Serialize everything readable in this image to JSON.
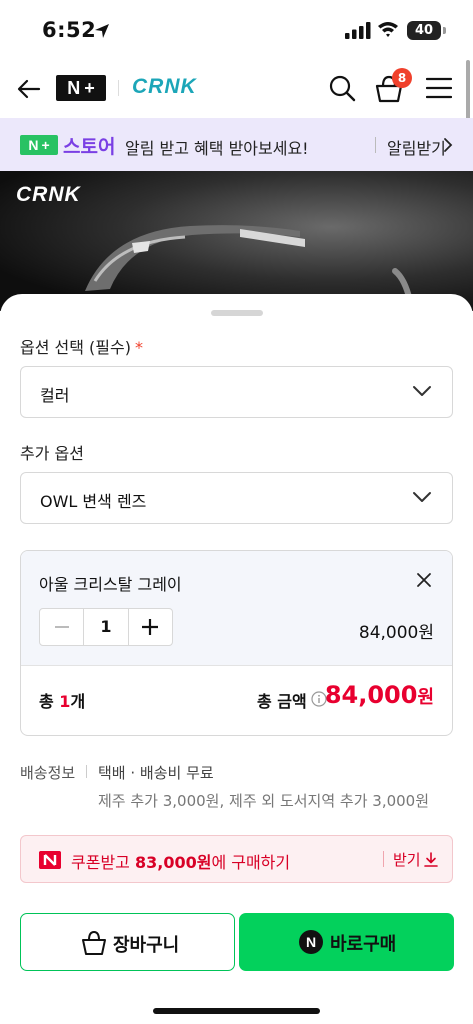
{
  "status_bar": {
    "time": "6:52",
    "battery": "40"
  },
  "header": {
    "brand": "CRNK",
    "cart_count": "8"
  },
  "promo": {
    "store_name": "스토어",
    "message": "알림 받고 혜택 받아보세요!",
    "action": "알림받기"
  },
  "product": {
    "brand_mark": "CRNK"
  },
  "options": {
    "required_label": "옵션 선택 (필수)",
    "required_star": "*",
    "color_select_value": "컬러",
    "extra_label": "추가 옵션",
    "extra_select_value": "OWL 변색 렌즈"
  },
  "selected_item": {
    "name": "아울 크리스탈 그레이",
    "quantity": "1",
    "price": "84,000원",
    "total_prefix": "총 ",
    "total_count_num": "1",
    "total_count_unit": "개",
    "total_label": "총 금액",
    "total_price": "84,000",
    "total_price_unit": "원"
  },
  "shipping": {
    "label": "배송정보",
    "value": "택배 · 배송비 무료",
    "extra": "제주 추가 3,000원, 제주 외 도서지역 추가 3,000원"
  },
  "coupon": {
    "prefix": "쿠폰받고 ",
    "amount": "83,000원",
    "suffix": "에 구매하기",
    "action": "받기"
  },
  "actions": {
    "cart_label": "장바구니",
    "buy_label": "바로구매",
    "buy_icon": "N"
  },
  "colors": {
    "accent_red": "#e8002f",
    "naver_green": "#03d15c",
    "store_purple": "#7a3fe4"
  }
}
